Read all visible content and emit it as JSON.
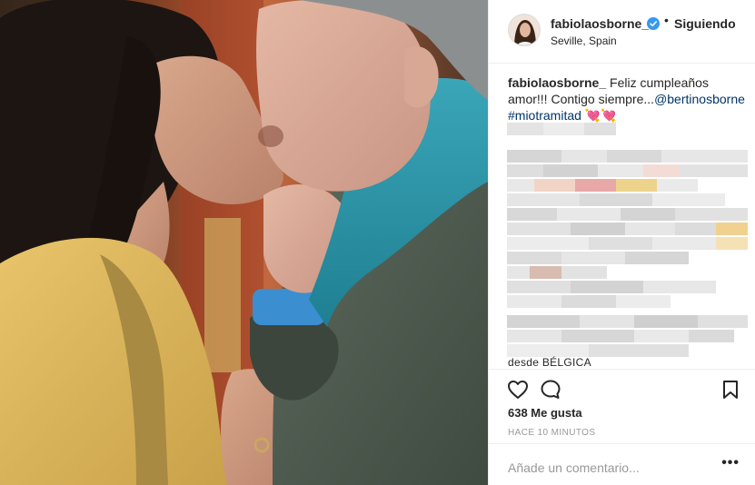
{
  "post": {
    "username": "fabiolaosborne_",
    "follow_status": "Siguiendo",
    "separator": "•",
    "location": "Seville, Spain",
    "caption_user": "fabiolaosborne_",
    "caption_text": " Feliz cumpleaños amor!!! Contigo siempre...",
    "caption_mention": "@bertinosborne",
    "caption_hashtag": "#miotramitad",
    "caption_emoji": "💘💘",
    "partial_comment": "desde BÉLGICA",
    "likes": "638 Me gusta",
    "timestamp": "HACE 10 MINUTOS",
    "comment_placeholder": "Añade un comentario...",
    "more_menu": "•••"
  },
  "icons": {
    "verified": "verified-badge-icon",
    "like": "heart-icon",
    "comment": "comment-bubble-icon",
    "save": "bookmark-icon",
    "more": "more-options-icon"
  },
  "colors": {
    "verified": "#3897f0",
    "link": "#003569",
    "muted": "#999999",
    "divider": "#efefef"
  }
}
